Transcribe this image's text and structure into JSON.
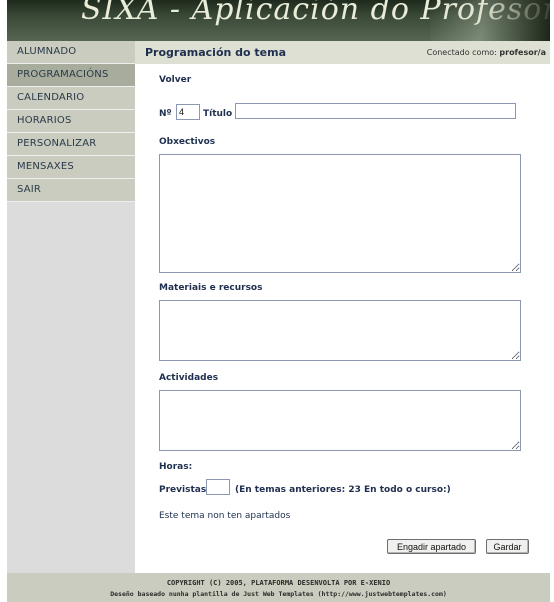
{
  "banner": {
    "title": "SIXA - Aplicación do Profesorado"
  },
  "sidebar": {
    "items": [
      {
        "label": "ALUMNADO"
      },
      {
        "label": "PROGRAMACIÓNS"
      },
      {
        "label": "CALENDARIO"
      },
      {
        "label": "HORARIOS"
      },
      {
        "label": "PERSONALIZAR"
      },
      {
        "label": "MENSAXES"
      },
      {
        "label": "SAIR"
      }
    ]
  },
  "header": {
    "title": "Programación do tema",
    "connected_prefix": "Conectado como:",
    "user": "profesor/a"
  },
  "form": {
    "back_link": "Volver",
    "number_label": "Nº",
    "number_value": "4",
    "title_label": "Título",
    "title_value": "",
    "objectives_label": "Obxectivos",
    "materials_label": "Materiais e recursos",
    "activities_label": "Actividades",
    "hours_label": "Horas:",
    "planned_label": "Previstas",
    "planned_value": "",
    "previous_info": "(En temas anteriores: 23 En todo o curso:)",
    "no_sections": "Este tema non ten apartados",
    "add_section_button": "Engadir apartado",
    "save_button": "Gardar"
  },
  "footer": {
    "line1": "COPYRIGHT (C) 2005, PLATAFORMA DESENVOLTA POR E-XENIO",
    "line2": "Deseño baseado nunha plantilla de Just Web Templates (http://www.justwebtemplates.com)"
  }
}
